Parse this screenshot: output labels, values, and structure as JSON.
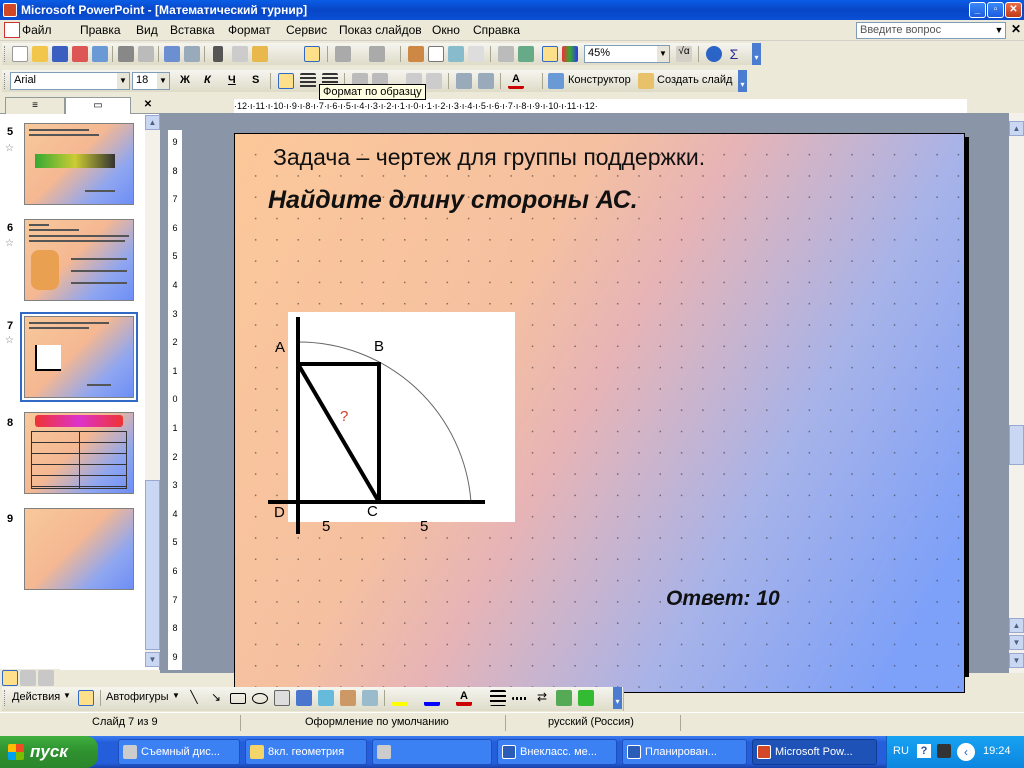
{
  "window": {
    "title": "Microsoft PowerPoint - [Математический турнир]"
  },
  "menu": {
    "items": [
      "Файл",
      "Правка",
      "Вид",
      "Вставка",
      "Формат",
      "Сервис",
      "Показ слайдов",
      "Окно",
      "Справка"
    ],
    "help_placeholder": "Введите вопрос"
  },
  "toolbar": {
    "zoom": "45%",
    "font": "Arial",
    "font_size": "18",
    "bold": "Ж",
    "italic": "К",
    "underline": "Ч",
    "shadow": "S",
    "designer": "Конструктор",
    "new_slide": "Создать слайд",
    "tooltip": "Формат по образцу"
  },
  "ruler": {
    "h_ticks": "·12·ı·11·ı·10·ı·9·ı·8·ı·7·ı·6·ı·5·ı·4·ı·3·ı·2·ı·1·ı·0·ı·1·ı·2·ı·3·ı·4·ı·5·ı·6·ı·7·ı·8·ı·9·ı·10·ı·11·ı·12·"
  },
  "thumbnails": [
    {
      "num": "5"
    },
    {
      "num": "6"
    },
    {
      "num": "7"
    },
    {
      "num": "8"
    },
    {
      "num": "9"
    }
  ],
  "slide": {
    "title": "Задача – чертеж для группы поддержки.",
    "subtitle": "Найдите длину стороны АС.",
    "labels": {
      "A": "А",
      "B": "В",
      "C": "С",
      "D": "D",
      "q": "?",
      "s1": "5",
      "s2": "5"
    },
    "answer": "Ответ:  10"
  },
  "drawing_toolbar": {
    "actions": "Действия",
    "autoshapes": "Автофигуры"
  },
  "status": {
    "slide": "Слайд 7 из 9",
    "design": "Оформление по умолчанию",
    "language": "русский (Россия)"
  },
  "taskbar": {
    "start": "пуск",
    "tasks": [
      "Съемный дис...",
      "8кл. геометрия",
      "",
      "Внекласс. ме...",
      "Планирован...",
      "Microsoft Pow..."
    ],
    "lang": "RU",
    "time": "19:24"
  }
}
